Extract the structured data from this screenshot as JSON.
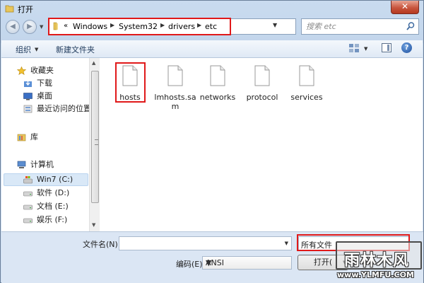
{
  "window": {
    "title": "打开",
    "close_label": "✕"
  },
  "nav": {
    "back_glyph": "◀",
    "forward_glyph": "▶"
  },
  "address": {
    "prefix": "«",
    "crumbs": [
      "Windows",
      "System32",
      "drivers",
      "etc"
    ]
  },
  "search": {
    "placeholder": "搜索 etc"
  },
  "toolbar": {
    "organize_label": "组织",
    "new_folder_label": "新建文件夹",
    "help_label": "?"
  },
  "sidebar": {
    "favorites_label": "收藏夹",
    "favorites": [
      {
        "label": "下载",
        "icon": "download-folder-icon"
      },
      {
        "label": "桌面",
        "icon": "desktop-icon"
      },
      {
        "label": "最近访问的位置",
        "icon": "recent-places-icon"
      }
    ],
    "libraries_label": "库",
    "computer_label": "计算机",
    "drives": [
      {
        "label": "Win7 (C:)",
        "icon": "system-drive-icon",
        "selected": true
      },
      {
        "label": "软件 (D:)",
        "icon": "drive-icon",
        "selected": false
      },
      {
        "label": "文档 (E:)",
        "icon": "drive-icon",
        "selected": false
      },
      {
        "label": "娱乐 (F:)",
        "icon": "drive-icon",
        "selected": false
      }
    ]
  },
  "files": [
    {
      "name": "hosts"
    },
    {
      "name": "lmhosts.sam"
    },
    {
      "name": "networks"
    },
    {
      "name": "protocol"
    },
    {
      "name": "services"
    }
  ],
  "bottom": {
    "filename_label": "文件名(N):",
    "filename_value": "",
    "filter_value": "所有文件",
    "encoding_label": "编码(E):",
    "encoding_value": "ANSI",
    "open_label": "打开("
  },
  "watermark": {
    "text": "雨林木风",
    "url": "www.YLMFU.COM"
  },
  "colors": {
    "highlight_red": "#e0191a",
    "window_blue": "#c9dbef",
    "selection": "#d9e8f7"
  }
}
